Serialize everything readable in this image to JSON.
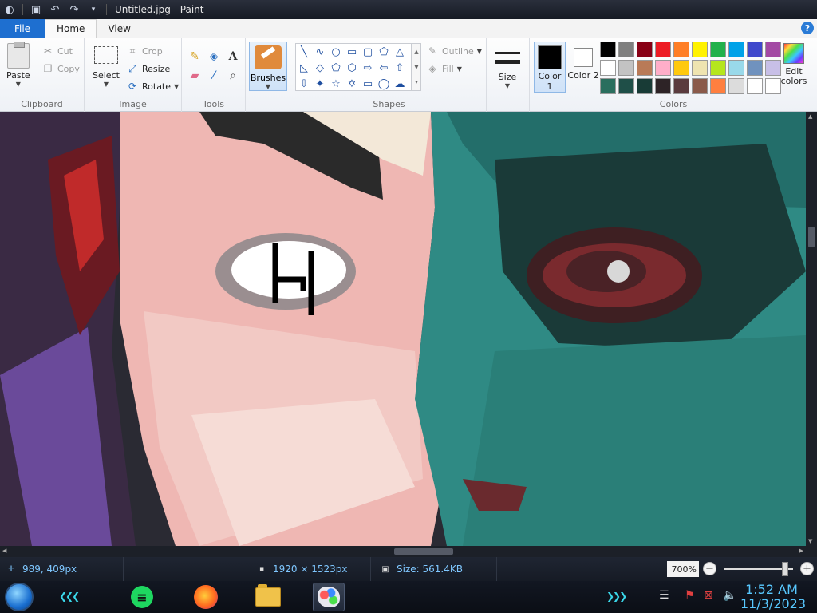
{
  "window": {
    "title": "Untitled.jpg - Paint"
  },
  "tabs": {
    "file": "File",
    "home": "Home",
    "view": "View"
  },
  "ribbon": {
    "clipboard": {
      "label": "Clipboard",
      "paste": "Paste",
      "cut": "Cut",
      "copy": "Copy"
    },
    "image": {
      "label": "Image",
      "select": "Select",
      "crop": "Crop",
      "resize": "Resize",
      "rotate": "Rotate"
    },
    "tools": {
      "label": "Tools",
      "brushes": "Brushes"
    },
    "shapes": {
      "label": "Shapes",
      "outline": "Outline",
      "fill": "Fill",
      "size": "Size"
    },
    "colors": {
      "label": "Colors",
      "color1": "Color 1",
      "color2": "Color 2",
      "color1_value": "#000000",
      "color2_value": "#ffffff",
      "edit": "Edit colors",
      "palette": [
        "#000000",
        "#7f7f7f",
        "#880015",
        "#ed1c24",
        "#ff7f27",
        "#fff200",
        "#22b14c",
        "#00a2e8",
        "#3f48cc",
        "#a349a4",
        "#ffffff",
        "#c3c3c3",
        "#b97a57",
        "#ffaec9",
        "#ffc90e",
        "#efe4b0",
        "#b5e61d",
        "#99d9ea",
        "#7092be",
        "#c8bfe7",
        "#2a6e5e",
        "#1f4f48",
        "#183b36",
        "#2d2326",
        "#5a3b3e",
        "#8a5a4a",
        "#ff7f3f",
        "#dcdcdc",
        "#ffffff",
        "#ffffff"
      ]
    }
  },
  "status": {
    "cursor": "989, 409px",
    "dimensions": "1920 × 1523px",
    "size": "Size: 561.4KB",
    "zoom": "700%"
  },
  "taskbar": {
    "time": "1:52 AM",
    "date": "11/3/2023"
  }
}
